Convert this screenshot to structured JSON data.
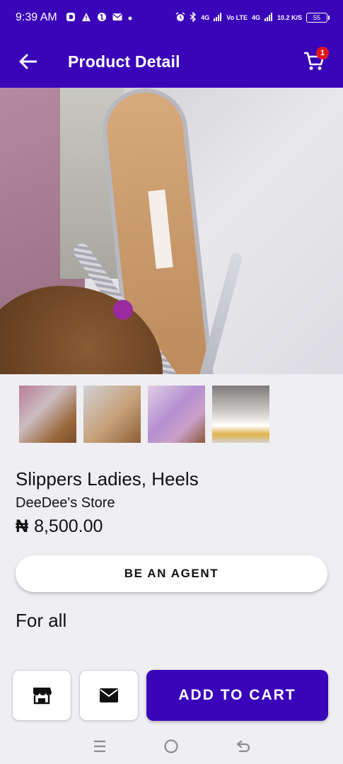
{
  "status_bar": {
    "time": "9:39 AM",
    "network_labels": [
      "4G",
      "Vo LTE",
      "4G",
      "10.2 K/S"
    ],
    "battery": "55"
  },
  "app_bar": {
    "title": "Product Detail",
    "cart_count": "1",
    "icons": [
      "back-arrow-icon",
      "cart-icon"
    ]
  },
  "gallery": {
    "slide_count": 4,
    "active_index": 0,
    "thumbnails": [
      "thumbnail-1",
      "thumbnail-2",
      "thumbnail-3",
      "thumbnail-4"
    ]
  },
  "product": {
    "name": "Slippers Ladies, Heels",
    "store": "DeeDee's Store",
    "currency_symbol": "₦",
    "price": "8,500.00",
    "description": "For all"
  },
  "buttons": {
    "agent": "BE AN AGENT",
    "add_to_cart": "ADD TO CART"
  },
  "colors": {
    "primary": "#3a05b9",
    "badge": "#e3161c",
    "background": "#efeef2"
  }
}
